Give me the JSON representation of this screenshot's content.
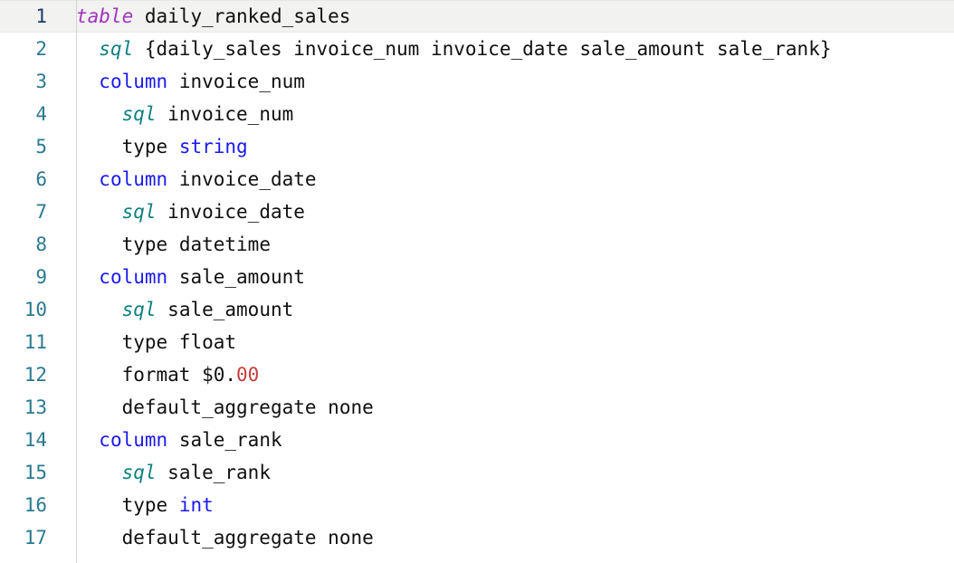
{
  "editor": {
    "name": "lookml-model-editor",
    "language": "LookML",
    "background_color": "#ffffff",
    "active_line": 1,
    "colors": {
      "keyword_table": "#a033c0",
      "keyword_sql": "#0d8080",
      "keyword_column": "#1a1aee",
      "value_type": "#1a1aee",
      "number_literal": "#c93b3b",
      "plain_text": "#101010",
      "gutter_number": "#2a7a90",
      "gutter_number_active": "#1a3a6b",
      "gutter_rule": "#d4d4d2",
      "active_line_background": "#f2f2f0"
    },
    "lines": [
      {
        "number": "1",
        "indent": 0,
        "active": true,
        "tokens": [
          {
            "text": "table",
            "kind": "table"
          },
          {
            "text": " ",
            "kind": "plain"
          },
          {
            "text": "daily_ranked_sales",
            "kind": "plain"
          }
        ]
      },
      {
        "number": "2",
        "indent": 1,
        "active": false,
        "tokens": [
          {
            "text": "sql",
            "kind": "sql"
          },
          {
            "text": " ",
            "kind": "plain"
          },
          {
            "text": "{daily_sales invoice_num invoice_date sale_amount sale_rank}",
            "kind": "plain"
          }
        ]
      },
      {
        "number": "3",
        "indent": 1,
        "active": false,
        "tokens": [
          {
            "text": "column",
            "kind": "column"
          },
          {
            "text": " ",
            "kind": "plain"
          },
          {
            "text": "invoice_num",
            "kind": "plain"
          }
        ]
      },
      {
        "number": "4",
        "indent": 2,
        "active": false,
        "tokens": [
          {
            "text": "sql",
            "kind": "sql"
          },
          {
            "text": " ",
            "kind": "plain"
          },
          {
            "text": "invoice_num",
            "kind": "plain"
          }
        ]
      },
      {
        "number": "5",
        "indent": 2,
        "active": false,
        "tokens": [
          {
            "text": "type",
            "kind": "type"
          },
          {
            "text": " ",
            "kind": "plain"
          },
          {
            "text": "string",
            "kind": "value"
          }
        ]
      },
      {
        "number": "6",
        "indent": 1,
        "active": false,
        "tokens": [
          {
            "text": "column",
            "kind": "column"
          },
          {
            "text": " ",
            "kind": "plain"
          },
          {
            "text": "invoice_date",
            "kind": "plain"
          }
        ]
      },
      {
        "number": "7",
        "indent": 2,
        "active": false,
        "tokens": [
          {
            "text": "sql",
            "kind": "sql"
          },
          {
            "text": " ",
            "kind": "plain"
          },
          {
            "text": "invoice_date",
            "kind": "plain"
          }
        ]
      },
      {
        "number": "8",
        "indent": 2,
        "active": false,
        "tokens": [
          {
            "text": "type",
            "kind": "type"
          },
          {
            "text": " ",
            "kind": "plain"
          },
          {
            "text": "datetime",
            "kind": "plain"
          }
        ]
      },
      {
        "number": "9",
        "indent": 1,
        "active": false,
        "tokens": [
          {
            "text": "column",
            "kind": "column"
          },
          {
            "text": " ",
            "kind": "plain"
          },
          {
            "text": "sale_amount",
            "kind": "plain"
          }
        ]
      },
      {
        "number": "10",
        "indent": 2,
        "active": false,
        "tokens": [
          {
            "text": "sql",
            "kind": "sql"
          },
          {
            "text": " ",
            "kind": "plain"
          },
          {
            "text": "sale_amount",
            "kind": "plain"
          }
        ]
      },
      {
        "number": "11",
        "indent": 2,
        "active": false,
        "tokens": [
          {
            "text": "type",
            "kind": "type"
          },
          {
            "text": " ",
            "kind": "plain"
          },
          {
            "text": "float",
            "kind": "plain"
          }
        ]
      },
      {
        "number": "12",
        "indent": 2,
        "active": false,
        "tokens": [
          {
            "text": "format",
            "kind": "type"
          },
          {
            "text": " ",
            "kind": "plain"
          },
          {
            "text": "$0.",
            "kind": "plain"
          },
          {
            "text": "00",
            "kind": "number"
          }
        ]
      },
      {
        "number": "13",
        "indent": 2,
        "active": false,
        "tokens": [
          {
            "text": "default_aggregate",
            "kind": "type"
          },
          {
            "text": " ",
            "kind": "plain"
          },
          {
            "text": "none",
            "kind": "plain"
          }
        ]
      },
      {
        "number": "14",
        "indent": 1,
        "active": false,
        "tokens": [
          {
            "text": "column",
            "kind": "column"
          },
          {
            "text": " ",
            "kind": "plain"
          },
          {
            "text": "sale_rank",
            "kind": "plain"
          }
        ]
      },
      {
        "number": "15",
        "indent": 2,
        "active": false,
        "tokens": [
          {
            "text": "sql",
            "kind": "sql"
          },
          {
            "text": " ",
            "kind": "plain"
          },
          {
            "text": "sale_rank",
            "kind": "plain"
          }
        ]
      },
      {
        "number": "16",
        "indent": 2,
        "active": false,
        "tokens": [
          {
            "text": "type",
            "kind": "type"
          },
          {
            "text": " ",
            "kind": "plain"
          },
          {
            "text": "int",
            "kind": "value"
          }
        ]
      },
      {
        "number": "17",
        "indent": 2,
        "active": false,
        "tokens": [
          {
            "text": "default_aggregate",
            "kind": "type"
          },
          {
            "text": " ",
            "kind": "plain"
          },
          {
            "text": "none",
            "kind": "plain"
          }
        ]
      }
    ]
  }
}
